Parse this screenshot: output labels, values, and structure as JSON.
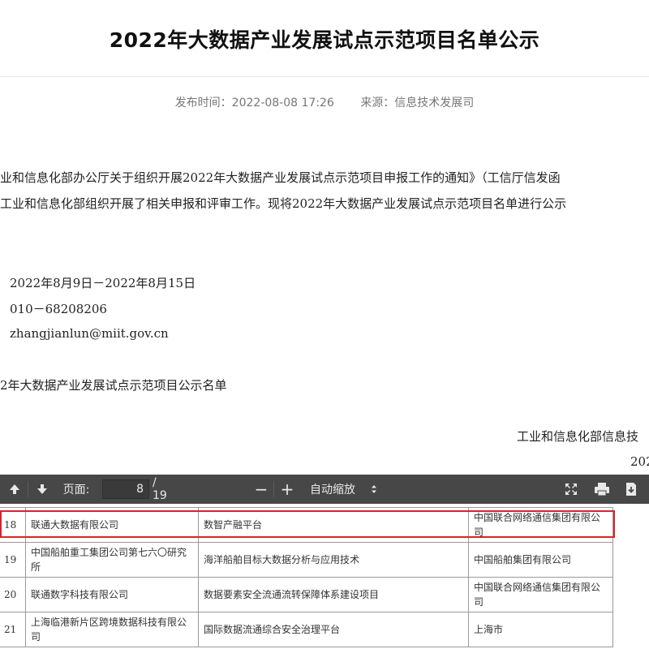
{
  "article": {
    "title": "2022年大数据产业发展试点示范项目名单公示",
    "publish_time": "发布时间：2022-08-08 17:26",
    "source": "来源：信息技术发展司",
    "paragraph_line_1": "业和信息化部办公厅关于组织开展2022年大数据产业发展试点示范项目申报工作的通知》（工信厅信发函",
    "paragraph_line_2": "工业和信息化部组织开展了相关申报和评审工作。现将2022年大数据产业发展试点示范项目名单进行公示",
    "period": "2022年8月9日－2022年8月15日",
    "phone": "010－68208206",
    "email": "zhangjianlun@miit.gov.cn",
    "attachment": "2年大数据产业发展试点示范项目公示名单",
    "signature": "工业和信息化部信息技",
    "signature_date": "202"
  },
  "pdf_viewer": {
    "page_label": "页面:",
    "current_page": "8",
    "total_pages": "/ 19",
    "zoom_label": "自动缩放",
    "zoom_out_symbol": "−",
    "zoom_in_symbol": "+"
  },
  "pdf_table": {
    "rows": [
      {
        "no": "18",
        "company": "联通大数据有限公司",
        "project": "数智产融平台",
        "unit": "中国联合网络通信集团有限公司",
        "highlighted": true
      },
      {
        "no": "19",
        "company": "中国船舶重工集团公司第七六〇研究所",
        "project": "海洋船舶目标大数据分析与应用技术",
        "unit": "中国船舶集团有限公司",
        "highlighted": false
      },
      {
        "no": "20",
        "company": "联通数字科技有限公司",
        "project": "数据要素安全流通流转保障体系建设项目",
        "unit": "中国联合网络通信集团有限公司",
        "highlighted": false
      },
      {
        "no": "21",
        "company": "上海临港新片区跨境数据科技有限公司",
        "project": "国际数据流通综合安全治理平台",
        "unit": "上海市",
        "highlighted": false
      }
    ]
  },
  "colors": {
    "toolbar": "#474747",
    "highlight": "#d9232d"
  }
}
